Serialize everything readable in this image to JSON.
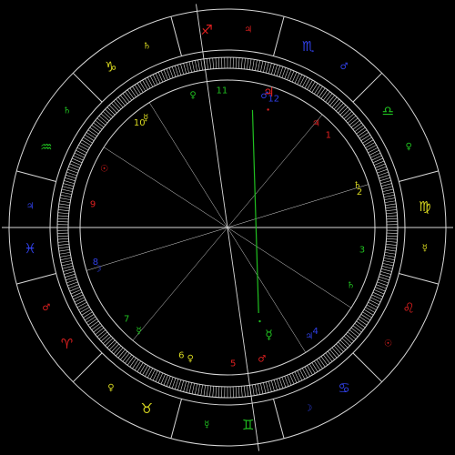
{
  "colors": {
    "background": "#000000",
    "lines": "#d8d8d8",
    "fire": "#e02020",
    "earth": "#d8d820",
    "air": "#20c020",
    "water": "#3040e8",
    "aspect_green": "#20c020"
  },
  "signs": [
    {
      "key": "aries",
      "glyph": "♈",
      "element": "fire",
      "ruler": "♂"
    },
    {
      "key": "taurus",
      "glyph": "♉",
      "element": "earth",
      "ruler": "♀"
    },
    {
      "key": "gemini",
      "glyph": "♊",
      "element": "air",
      "ruler": "☿"
    },
    {
      "key": "cancer",
      "glyph": "♋",
      "element": "water",
      "ruler": "☽"
    },
    {
      "key": "leo",
      "glyph": "♌",
      "element": "fire",
      "ruler": "☉"
    },
    {
      "key": "virgo",
      "glyph": "♍",
      "element": "earth",
      "ruler": "☿"
    },
    {
      "key": "libra",
      "glyph": "♎",
      "element": "air",
      "ruler": "♀"
    },
    {
      "key": "scorpio",
      "glyph": "♏",
      "element": "water",
      "ruler": "♂"
    },
    {
      "key": "sagittarius",
      "glyph": "♐",
      "element": "fire",
      "ruler": "♃"
    },
    {
      "key": "capricorn",
      "glyph": "♑",
      "element": "earth",
      "ruler": "♄"
    },
    {
      "key": "aquarius",
      "glyph": "♒",
      "element": "air",
      "ruler": "♄"
    },
    {
      "key": "pisces",
      "glyph": "♓",
      "element": "water",
      "ruler": "♃"
    }
  ],
  "houses": [
    {
      "number": "1",
      "element": "fire",
      "ruler": "♂"
    },
    {
      "number": "2",
      "element": "earth",
      "ruler": "♀"
    },
    {
      "number": "3",
      "element": "air",
      "ruler": "☿"
    },
    {
      "number": "4",
      "element": "water",
      "ruler": "☽"
    },
    {
      "number": "5",
      "element": "fire",
      "ruler": "☉"
    },
    {
      "number": "6",
      "element": "earth",
      "ruler": "☿"
    },
    {
      "number": "7",
      "element": "air",
      "ruler": "♀"
    },
    {
      "number": "8",
      "element": "water",
      "ruler": "♂"
    },
    {
      "number": "9",
      "element": "fire",
      "ruler": "♃"
    },
    {
      "number": "10",
      "element": "earth",
      "ruler": "♄"
    },
    {
      "number": "11",
      "element": "air",
      "ruler": "♄"
    },
    {
      "number": "12",
      "element": "water",
      "ruler": "♃"
    }
  ],
  "planets": [
    {
      "key": "jupiter",
      "glyph": "♃",
      "element": "fire"
    },
    {
      "key": "mercury",
      "glyph": "☿",
      "element": "air"
    }
  ]
}
